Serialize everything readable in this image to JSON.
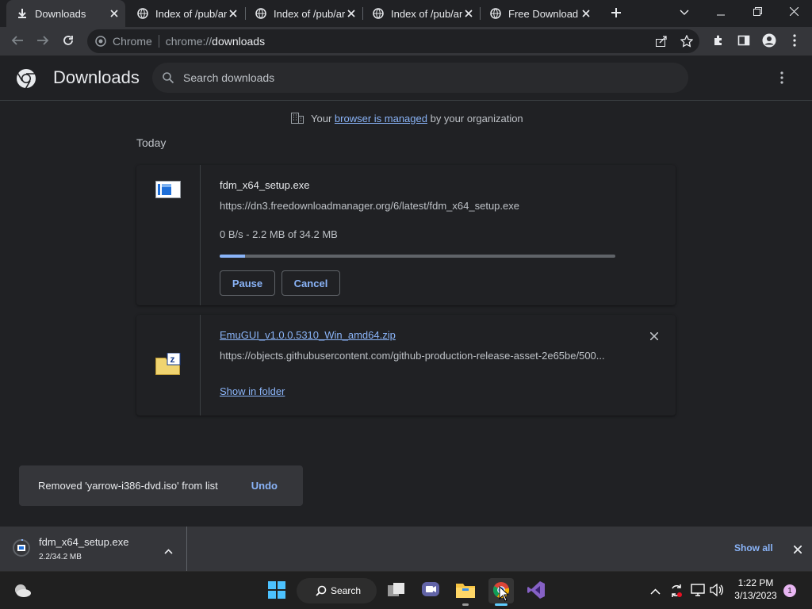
{
  "tabs": [
    {
      "title": "Downloads",
      "icon": "download-icon",
      "active": true
    },
    {
      "title": "Index of /pub/ar",
      "icon": "globe-icon",
      "active": false
    },
    {
      "title": "Index of /pub/ar",
      "icon": "globe-icon",
      "active": false
    },
    {
      "title": "Index of /pub/ar",
      "icon": "globe-icon",
      "active": false
    },
    {
      "title": "Free Download",
      "icon": "globe-icon",
      "active": false
    }
  ],
  "omnibox": {
    "site": "Chrome",
    "url_scheme": "chrome://",
    "url_host": "downloads"
  },
  "header": {
    "title": "Downloads",
    "search_placeholder": "Search downloads"
  },
  "managed": {
    "prefix": "Your",
    "link": "browser is managed",
    "suffix": "by your organization"
  },
  "section_today": "Today",
  "downloads": [
    {
      "filename": "fdm_x64_setup.exe",
      "url": "https://dn3.freedownloadmanager.org/6/latest/fdm_x64_setup.exe",
      "status": "0 B/s - 2.2 MB of 34.2 MB",
      "progress": 0.064,
      "pause_label": "Pause",
      "cancel_label": "Cancel"
    },
    {
      "filename": "EmuGUI_v1.0.0.5310_Win_amd64.zip",
      "url": "https://objects.githubusercontent.com/github-production-release-asset-2e65be/500...",
      "show_in_folder": "Show in folder"
    }
  ],
  "toast": {
    "message": "Removed 'yarrow-i386-dvd.iso' from list",
    "undo": "Undo"
  },
  "shelf": {
    "filename": "fdm_x64_setup.exe",
    "size": "2.2/34.2 MB",
    "show_all": "Show all"
  },
  "taskbar": {
    "search": "Search",
    "time": "1:22 PM",
    "date": "3/13/2023",
    "badge": "1"
  },
  "colors": {
    "accent": "#8ab4f8",
    "bg": "#202124",
    "toolbar": "#35363a"
  }
}
